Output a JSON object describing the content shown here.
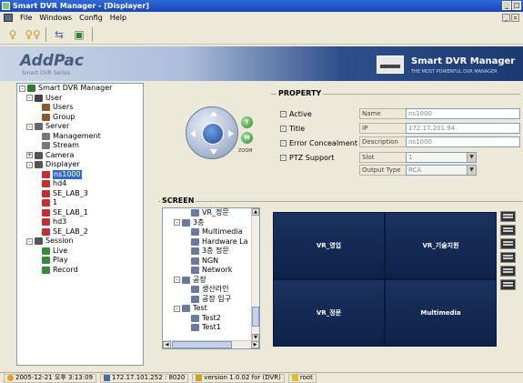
{
  "window": {
    "title": "Smart DVR Manager - [Displayer]"
  },
  "menu": [
    "File",
    "Windows",
    "Config",
    "Help"
  ],
  "toolbar": [
    "user-icon",
    "group-icon",
    "server-icon",
    "camera-icon"
  ],
  "banner": {
    "logo": "AddPac",
    "logo_sub": "Smart DVR Series",
    "product": "Smart DVR Manager",
    "product_sub": "THE MOST POWERFUL DVR MANAGER"
  },
  "tree": [
    {
      "label": "Smart DVR Manager",
      "depth": 0,
      "exp": "-",
      "color": "#2d7a2d"
    },
    {
      "label": "User",
      "depth": 1,
      "exp": "-",
      "color": "#444"
    },
    {
      "label": "Users",
      "depth": 2,
      "exp": "",
      "color": "#8a5a2a"
    },
    {
      "label": "Group",
      "depth": 2,
      "exp": "",
      "color": "#8a5a2a"
    },
    {
      "label": "Server",
      "depth": 1,
      "exp": "-",
      "color": "#666"
    },
    {
      "label": "Management",
      "depth": 2,
      "exp": "",
      "color": "#777"
    },
    {
      "label": "Stream",
      "depth": 2,
      "exp": "",
      "color": "#777"
    },
    {
      "label": "Camera",
      "depth": 1,
      "exp": "+",
      "color": "#555"
    },
    {
      "label": "Displayer",
      "depth": 1,
      "exp": "-",
      "color": "#555"
    },
    {
      "label": "ns1000",
      "depth": 2,
      "exp": "",
      "color": "#c03030",
      "selected": true
    },
    {
      "label": "hd4",
      "depth": 2,
      "exp": "",
      "color": "#c03030"
    },
    {
      "label": "SE_LAB_3",
      "depth": 2,
      "exp": "",
      "color": "#c03030"
    },
    {
      "label": "1",
      "depth": 2,
      "exp": "",
      "color": "#c03030"
    },
    {
      "label": "SE_LAB_1",
      "depth": 2,
      "exp": "",
      "color": "#c03030"
    },
    {
      "label": "hd3",
      "depth": 2,
      "exp": "",
      "color": "#c03030"
    },
    {
      "label": "SE_LAB_2",
      "depth": 2,
      "exp": "",
      "color": "#c03030"
    },
    {
      "label": "Session",
      "depth": 1,
      "exp": "-",
      "color": "#555"
    },
    {
      "label": "Live",
      "depth": 2,
      "exp": "",
      "color": "#3a8a3a"
    },
    {
      "label": "Play",
      "depth": 2,
      "exp": "",
      "color": "#3a8a3a"
    },
    {
      "label": "Record",
      "depth": 2,
      "exp": "",
      "color": "#3a8a3a"
    }
  ],
  "property": {
    "title": "PROPERTY",
    "checks": [
      "Active",
      "Title",
      "Error Concealment",
      "PTZ Support"
    ],
    "fields": [
      {
        "label": "Name",
        "value": "ns1000"
      },
      {
        "label": "IP",
        "value": "172.17.201.94"
      },
      {
        "label": "Description",
        "value": "ns1000"
      }
    ],
    "selects": [
      {
        "label": "Slot",
        "value": "1"
      },
      {
        "label": "Output Type",
        "value": "RCA"
      }
    ],
    "zoom_label": "ZOOM"
  },
  "screen": {
    "title": "SCREEN",
    "list": [
      {
        "label": "VR_정문",
        "depth": 2,
        "exp": ""
      },
      {
        "label": "3층",
        "depth": 1,
        "exp": "-"
      },
      {
        "label": "Multimedia",
        "depth": 2,
        "exp": ""
      },
      {
        "label": "Hardware La",
        "depth": 2,
        "exp": ""
      },
      {
        "label": "3층 정문",
        "depth": 2,
        "exp": ""
      },
      {
        "label": "NGN",
        "depth": 2,
        "exp": ""
      },
      {
        "label": "Network",
        "depth": 2,
        "exp": ""
      },
      {
        "label": "공장",
        "depth": 1,
        "exp": "-"
      },
      {
        "label": "생산라인",
        "depth": 2,
        "exp": ""
      },
      {
        "label": "공장 입구",
        "depth": 2,
        "exp": ""
      },
      {
        "label": "Test",
        "depth": 1,
        "exp": "-"
      },
      {
        "label": "Test2",
        "depth": 2,
        "exp": ""
      },
      {
        "label": "Test1",
        "depth": 2,
        "exp": ""
      }
    ],
    "cells": [
      "VR_영업",
      "VR_기술지원",
      "VR_정문",
      "Multimedia"
    ]
  },
  "status": {
    "datetime": "2005-12-21 오후 3:13:09",
    "server": "172.17.101.252 : 8020",
    "version": "version 1.0.02 for (DVR)",
    "user": "root"
  }
}
